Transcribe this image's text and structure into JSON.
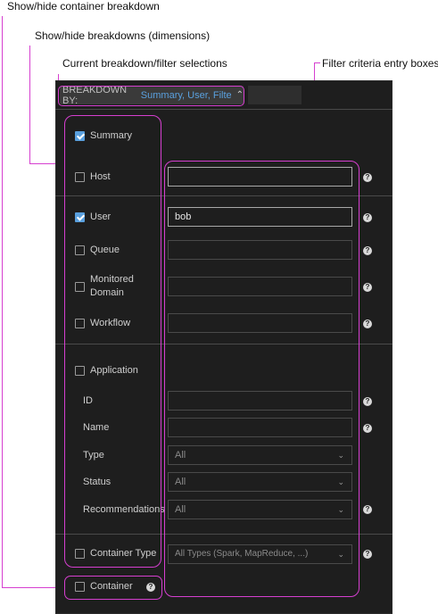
{
  "callouts": {
    "container_breakdown": "Show/hide container breakdown",
    "breakdowns": "Show/hide breakdowns (dimensions)",
    "current_selection": "Current breakdown/filter selections",
    "filter_criteria": "Filter criteria entry boxes"
  },
  "breakdown_button": {
    "label": "BREAKDOWN BY:",
    "selection": "Summary, User, Filte...",
    "chevron": "⌃"
  },
  "rows": {
    "summary": {
      "label": "Summary",
      "checked": true
    },
    "host": {
      "label": "Host",
      "checked": false,
      "value": ""
    },
    "user": {
      "label": "User",
      "checked": true,
      "value": "bob"
    },
    "queue": {
      "label": "Queue",
      "checked": false,
      "value": ""
    },
    "monitored_domain": {
      "label1": "Monitored",
      "label2": "Domain",
      "checked": false,
      "value": ""
    },
    "workflow": {
      "label": "Workflow",
      "checked": false,
      "value": ""
    },
    "application": {
      "label": "Application",
      "checked": false
    },
    "id": {
      "label": "ID",
      "value": ""
    },
    "name": {
      "label": "Name",
      "value": ""
    },
    "type": {
      "label": "Type",
      "value": "All"
    },
    "status": {
      "label": "Status",
      "value": "All"
    },
    "recommendations": {
      "label": "Recommendations",
      "value": "All"
    },
    "container_type": {
      "label": "Container Type",
      "checked": false,
      "value": "All Types (Spark, MapReduce, ...)"
    },
    "container": {
      "label": "Container",
      "checked": false
    }
  },
  "icons": {
    "help": "?",
    "dropdown": "⌄"
  },
  "colors": {
    "accent": "#5aa0de",
    "callout_line": "#d63fd0",
    "panel_bg": "#1e1e1e"
  }
}
